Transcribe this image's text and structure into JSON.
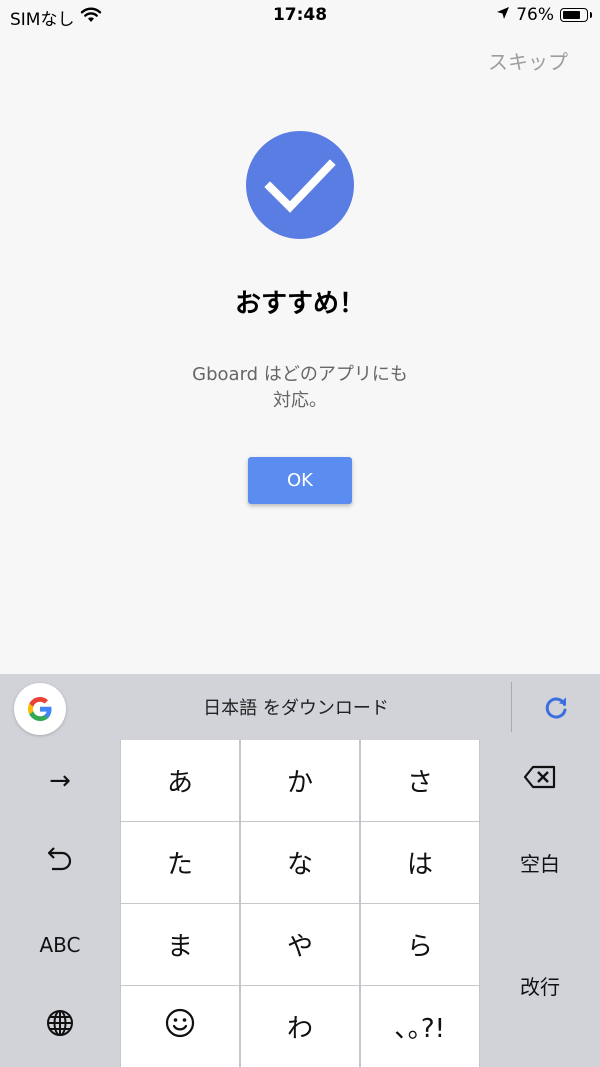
{
  "status_bar": {
    "carrier": "SIMなし",
    "time": "17:48",
    "battery_percent": "76%",
    "battery_level": 0.76
  },
  "header": {
    "skip_label": "スキップ"
  },
  "main": {
    "title": "おすすめ！",
    "description_line1": "Gboard はどのアプリにも",
    "description_line2": "対応。",
    "ok_label": "OK",
    "accent_color": "#5a7de3"
  },
  "keyboard": {
    "suggestion": "日本語 をダウンロード",
    "keys": {
      "arrow": "→",
      "a": "あ",
      "ka": "か",
      "sa": "さ",
      "ta": "た",
      "na": "な",
      "ha": "は",
      "ma": "ま",
      "ya": "や",
      "ra": "ら",
      "wa": "わ",
      "punct": "､｡?!",
      "space": "空白",
      "abc": "ABC",
      "enter": "改行"
    }
  }
}
